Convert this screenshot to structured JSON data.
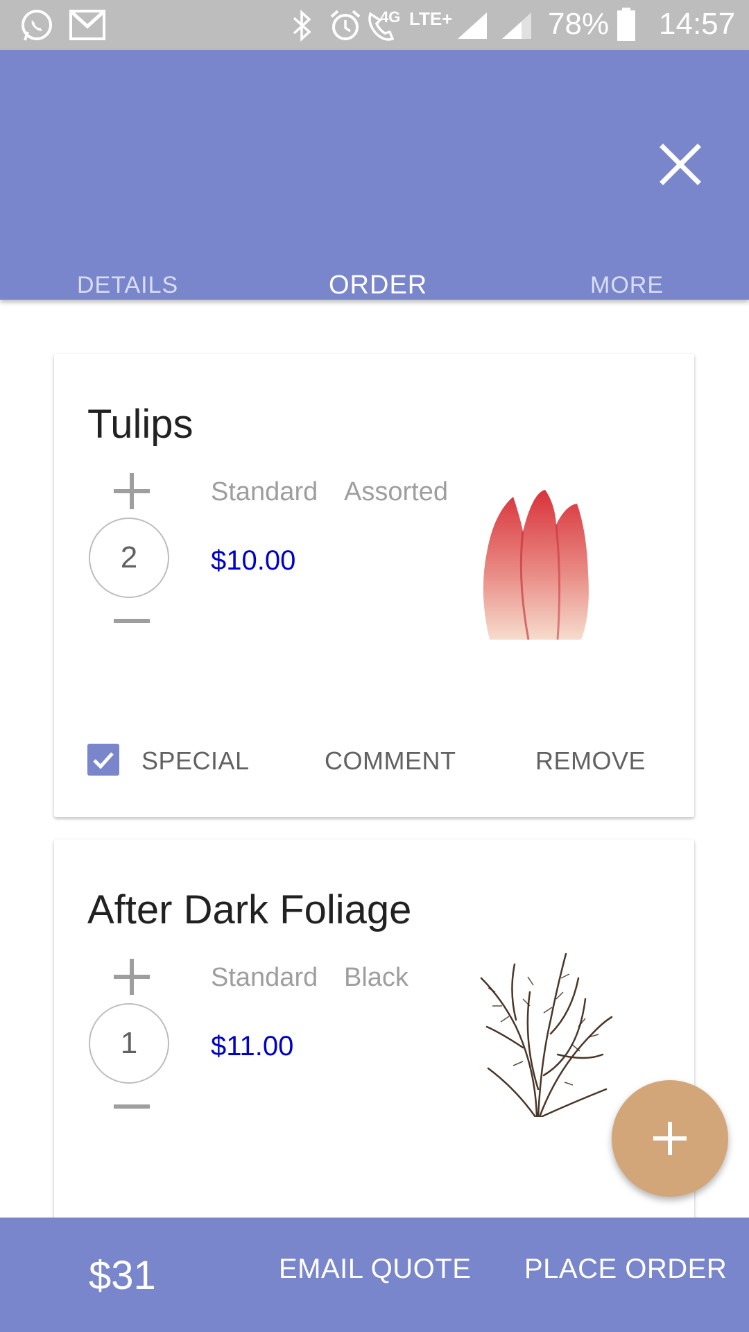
{
  "status_bar": {
    "network_label": "4G",
    "lte_label": "LTE+",
    "battery": "78%",
    "time": "14:57",
    "icons": [
      "whatsapp-icon",
      "gmail-icon",
      "bluetooth-icon",
      "alarm-icon",
      "wifi-call-icon",
      "signal-icon",
      "signal-icon",
      "battery-icon"
    ]
  },
  "header": {
    "tabs": [
      {
        "label": "DETAILS",
        "active": false
      },
      {
        "label": "ORDER",
        "active": true
      },
      {
        "label": "MORE",
        "active": false
      }
    ],
    "close_icon": "close-icon"
  },
  "items": [
    {
      "name": "Tulips",
      "quantity": "2",
      "grade": "Standard",
      "color": "Assorted",
      "price": "$10.00",
      "image": "tulip-image",
      "special_checked": true,
      "actions": {
        "special": "SPECIAL",
        "comment": "COMMENT",
        "remove": "REMOVE"
      }
    },
    {
      "name": "After Dark Foliage",
      "quantity": "1",
      "grade": "Standard",
      "color": "Black",
      "price": "$11.00",
      "image": "foliage-image"
    }
  ],
  "fab": {
    "icon": "plus-icon"
  },
  "footer": {
    "total": "$31",
    "email_quote": "EMAIL QUOTE",
    "place_order": "PLACE ORDER"
  },
  "colors": {
    "primary": "#7986cb",
    "accent": "#d2a679",
    "price": "#0000cc",
    "status_bar": "#bdbdbd"
  }
}
